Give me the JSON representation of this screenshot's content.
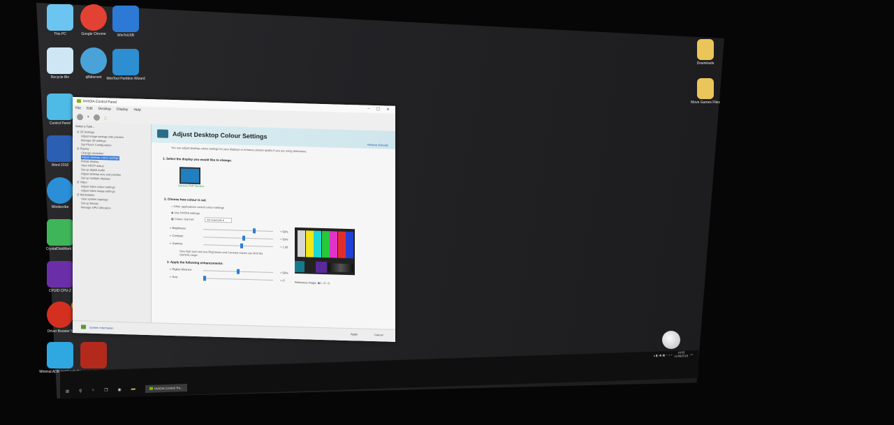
{
  "desktop": {
    "icons_left": [
      {
        "label": "This PC",
        "icon": "computer-icon",
        "color": "#6cc4f0"
      },
      {
        "label": "Google Chrome",
        "icon": "chrome-icon",
        "color": "#e34133"
      },
      {
        "label": "WinToUSB",
        "icon": "wintousb-icon",
        "color": "#2d7ad6"
      },
      {
        "label": "Recycle Bin",
        "icon": "recycle-bin-icon",
        "color": "#cfe7f5"
      },
      {
        "label": "qBittorrent",
        "icon": "qbittorrent-icon",
        "color": "#4aa3d8"
      },
      {
        "label": "MiniTool Partition Wizard",
        "icon": "partition-wizard-icon",
        "color": "#2d8ed1"
      },
      {
        "label": "Control Panel",
        "icon": "control-panel-icon",
        "color": "#4dbbe6"
      },
      {
        "label": "Word 2016",
        "icon": "word-icon",
        "color": "#2b5fb4"
      },
      {
        "label": "Windscribe",
        "icon": "windscribe-icon",
        "color": "#2a8fd6"
      },
      {
        "label": "CrystalDiskMark 5",
        "icon": "crystaldiskmark-icon",
        "color": "#3fb55a"
      },
      {
        "label": "CPUID CPU-Z",
        "icon": "cpuz-icon",
        "color": "#6a2fa8"
      },
      {
        "label": "Driver Booster 5",
        "icon": "driver-booster-icon",
        "color": "#d3301f"
      },
      {
        "label": "Minimal ADB and Fastboot",
        "icon": "adb-icon",
        "color": "#2fa7e0"
      },
      {
        "label": "Company of Heroes 2",
        "icon": "coh2-icon",
        "color": "#b32a1c"
      }
    ],
    "icons_right": [
      {
        "label": "Downloads",
        "icon": "downloads-folder-icon",
        "color": "#e9c55a"
      },
      {
        "label": "Move Games Files",
        "icon": "folder-icon",
        "color": "#e9c55a"
      }
    ],
    "badge": "1"
  },
  "window": {
    "title": "NVIDIA Control Panel",
    "controls": [
      "–",
      "☐",
      "✕"
    ],
    "menu": [
      "File",
      "Edit",
      "Desktop",
      "Display",
      "Help"
    ],
    "select_task": "Select a Task...",
    "tree": [
      "3D Settings",
      "Adjust image settings with preview",
      "Manage 3D settings",
      "Set PhysX Configuration",
      "Display",
      "Change resolution",
      "Adjust desktop colour settings",
      "Rotate display",
      "View HDCP status",
      "Set up digital audio",
      "Adjust desktop size and position",
      "Set up multiple displays",
      "Video",
      "Adjust video colour settings",
      "Adjust video image settings",
      "Workstation",
      "View system topology",
      "Set up Mosaic",
      "Manage GPU Utilization"
    ],
    "selected_index": 6,
    "page_title": "Adjust Desktop Colour Settings",
    "restore_defaults": "Restore Defaults",
    "intro": "You can adjust desktop colour settings for your displays or enhance picture quality if you are using televisions.",
    "step1": "1. Select the display you would like to change.",
    "display_name": "Generic PnP Monitor",
    "step2": "2. Choose how colour is set.",
    "radio_other": "Other applications control colour settings",
    "radio_nvidia": "Use NVIDIA settings",
    "colour_channel_label": "Colour channel:",
    "colour_channel_value": "All channels",
    "sliders": [
      {
        "label": "Brightness:",
        "value": "+ 50%",
        "pos": 0.74
      },
      {
        "label": "Contrast:",
        "value": "+ 50%",
        "pos": 0.58
      },
      {
        "label": "Gamma:",
        "value": "+ 1.00",
        "pos": 0.55
      }
    ],
    "gamma_note": "Very high and very low Brightness and Contrast values can limit the Gamma range",
    "step3": "3. Apply the following enhancements:",
    "enhancements": [
      {
        "label": "Digital vibrance:",
        "value": "+ 50%",
        "pos": 0.5
      },
      {
        "label": "Hue:",
        "value": "+ 0°",
        "pos": 0.0
      }
    ],
    "reference_label": "Reference image:",
    "reference_options": [
      "1",
      "2",
      "3"
    ],
    "pattern_colors": [
      "#d6d6d6",
      "#f2e51a",
      "#1fd6d6",
      "#25c93a",
      "#e033c8",
      "#e32d2d",
      "#2240d6"
    ],
    "system_info": "System Information",
    "apply": "Apply",
    "cancel": "Cancel"
  },
  "taskbar": {
    "active_app": "NVIDIA Control Pa...",
    "time": "16:05",
    "date": "11/06/2019"
  }
}
